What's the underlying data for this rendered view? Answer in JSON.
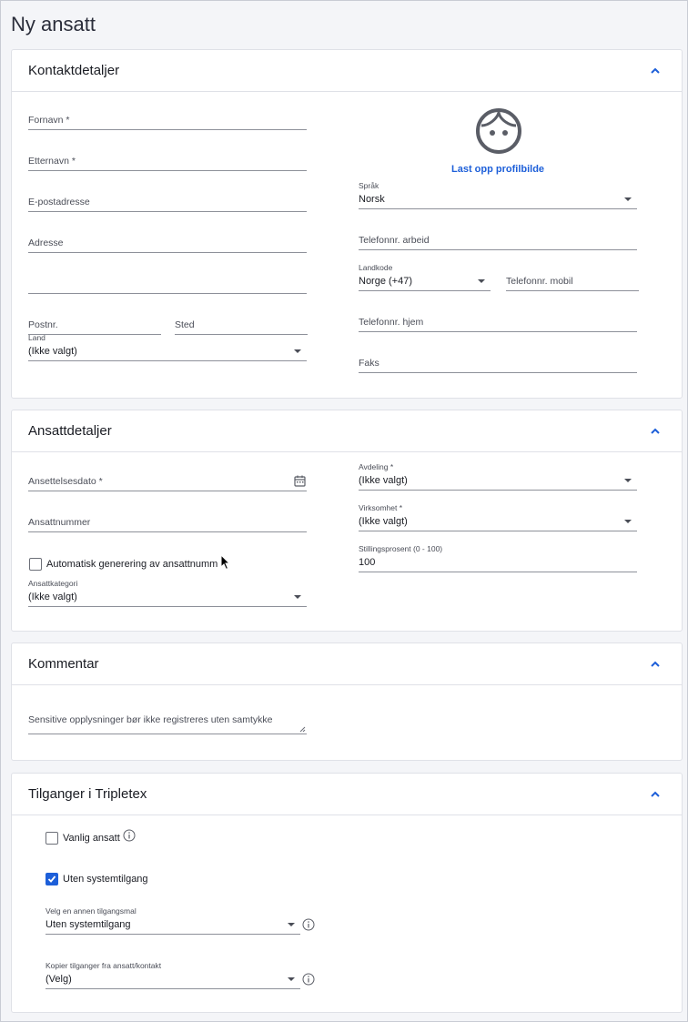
{
  "page": {
    "title": "Ny ansatt"
  },
  "contact": {
    "title": "Kontaktdetaljer",
    "first_name": "Fornavn *",
    "last_name": "Etternavn *",
    "email": "E-postadresse",
    "address": "Adresse",
    "postal_code": "Postnr.",
    "city": "Sted",
    "country_label": "Land",
    "country_value": "(Ikke valgt)",
    "upload_link": "Last opp profilbilde",
    "language_label": "Språk",
    "language_value": "Norsk",
    "phone_work": "Telefonnr. arbeid",
    "country_code_label": "Landkode",
    "country_code_value": "Norge (+47)",
    "phone_mobile": "Telefonnr. mobil",
    "phone_home": "Telefonnr. hjem",
    "fax": "Faks"
  },
  "employee": {
    "title": "Ansattdetaljer",
    "start_date": "Ansettelsesdato *",
    "employee_number": "Ansattnummer",
    "auto_generate": "Automatisk generering av ansattnumm",
    "category_label": "Ansattkategori",
    "category_value": "(Ikke valgt)",
    "department_label": "Avdeling *",
    "department_value": "(Ikke valgt)",
    "business_label": "Virksomhet *",
    "business_value": "(Ikke valgt)",
    "percentage_label": "Stillingsprosent (0 - 100)",
    "percentage_value": "100"
  },
  "comment": {
    "title": "Kommentar",
    "placeholder": "Sensitive opplysninger bør ikke registreres uten samtykke"
  },
  "access": {
    "title": "Tilganger i Tripletex",
    "regular_employee": "Vanlig ansatt",
    "regular_employee_checked": false,
    "no_system_access": "Uten systemtilgang",
    "no_system_access_checked": true,
    "template_label": "Velg en annen tilgangsmal",
    "template_value": "Uten systemtilgang",
    "copy_label": "Kopier tilganger fra ansatt/kontakt",
    "copy_value": "(Velg)"
  },
  "colors": {
    "accent": "#1d5fd9",
    "border": "#dfe1e7",
    "background": "#f4f5f8"
  },
  "icons": {
    "collapse": "chevron-up-icon",
    "avatar": "face-icon",
    "calendar": "calendar-icon",
    "info": "info-icon"
  }
}
